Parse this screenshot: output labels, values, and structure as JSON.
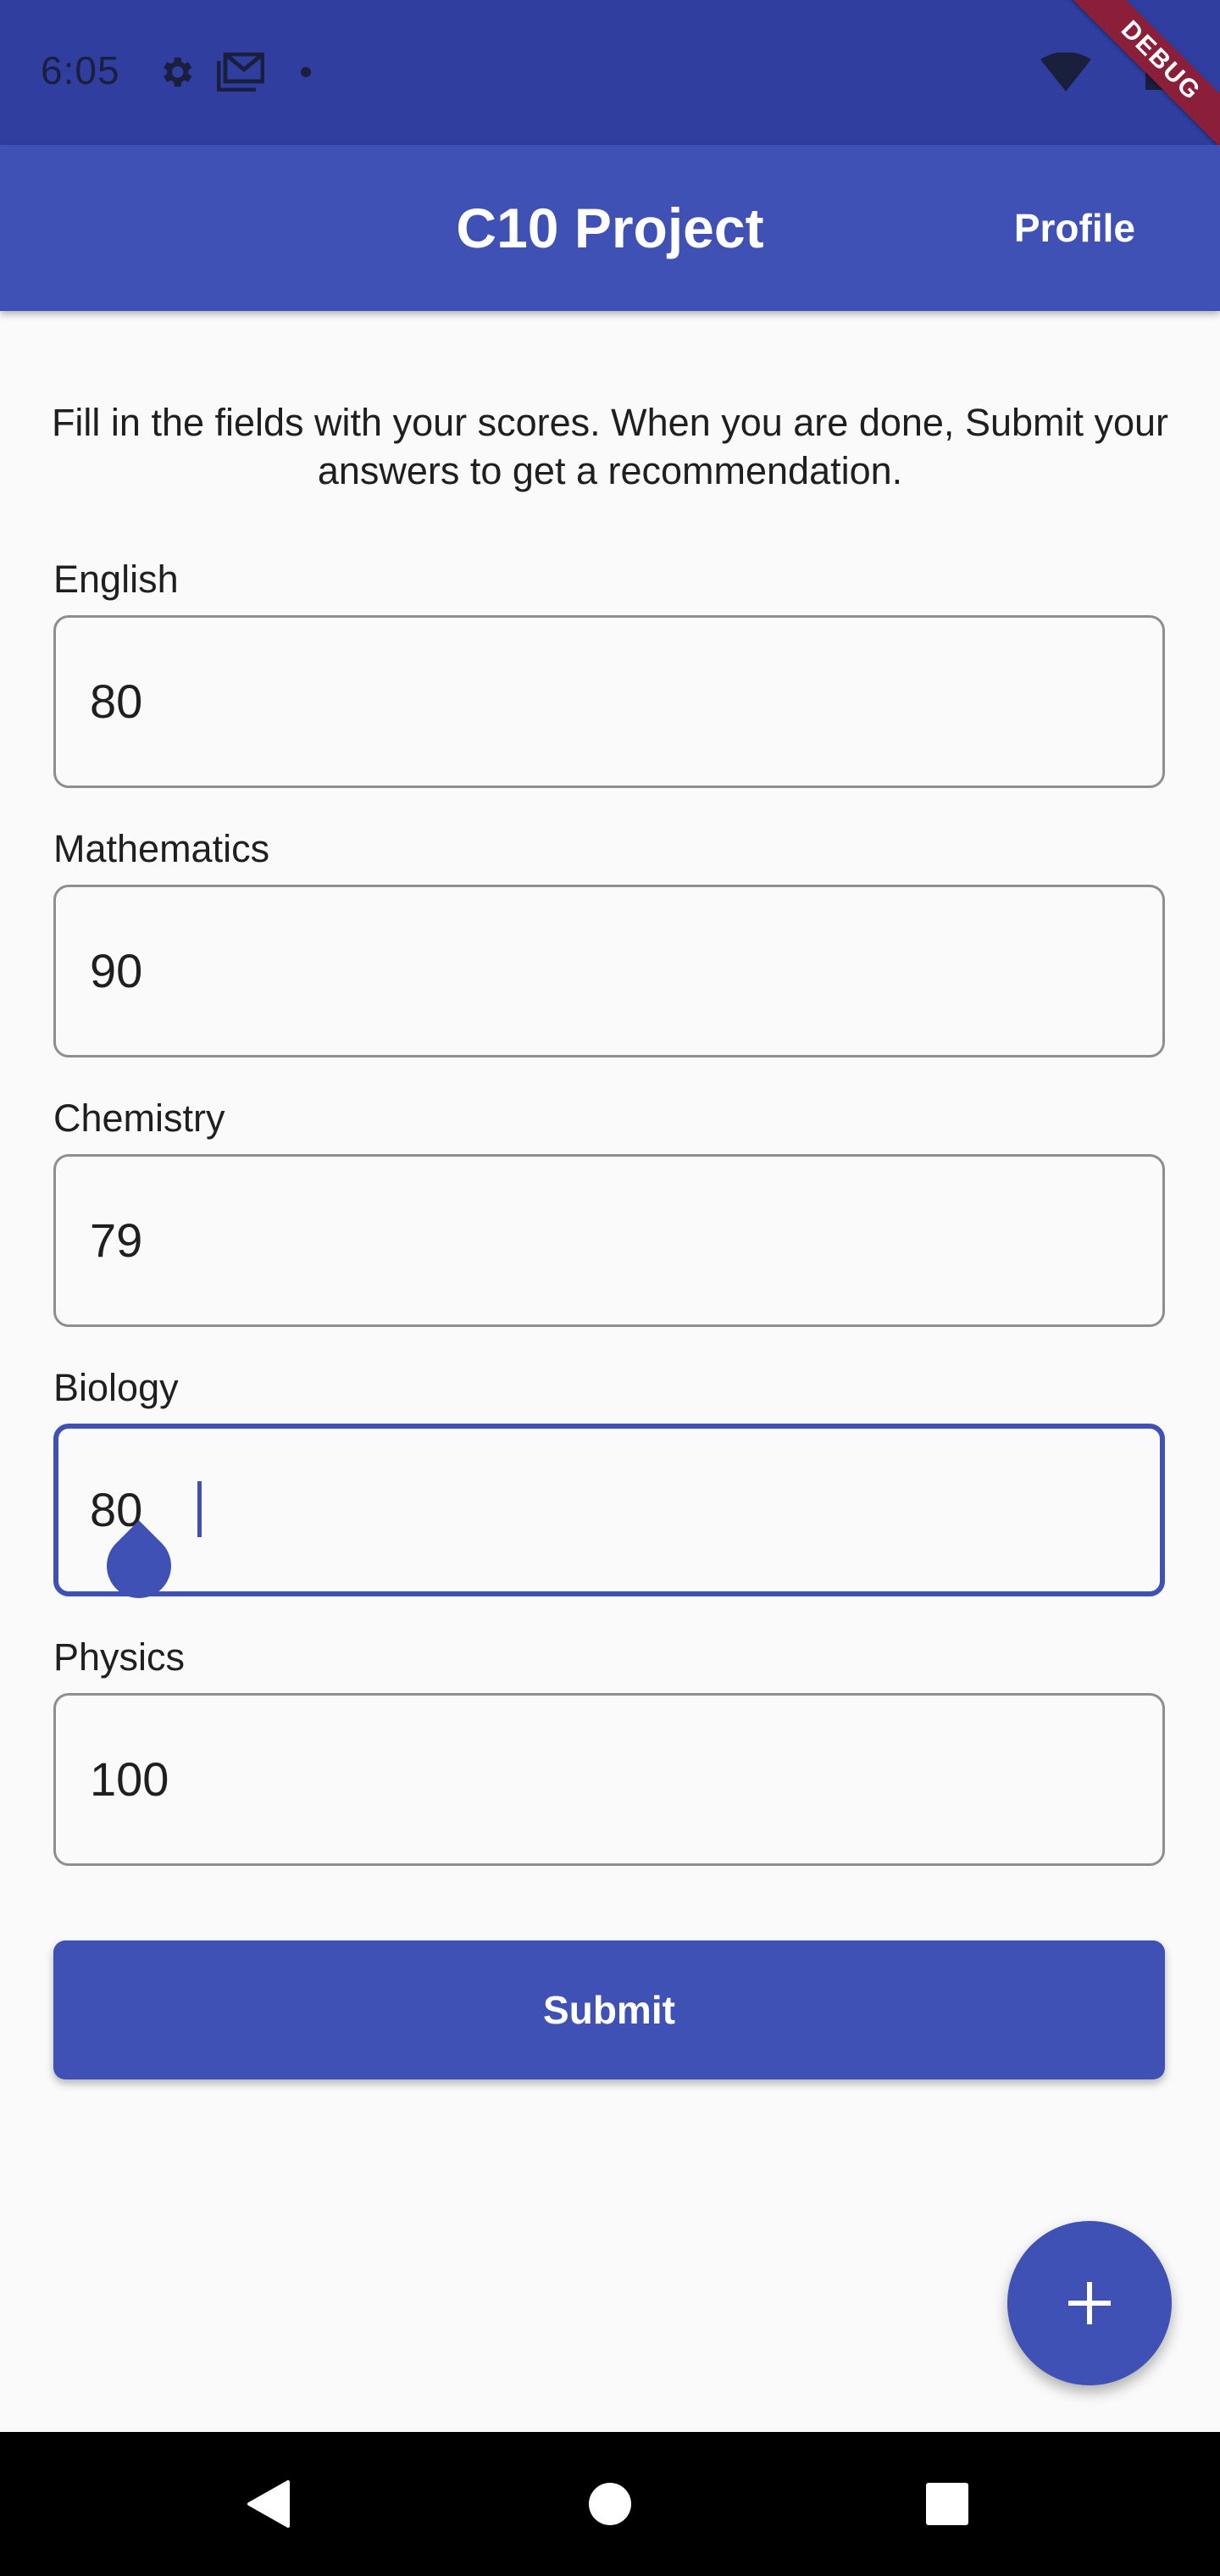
{
  "status_bar": {
    "time": "6:05",
    "icons": [
      "settings-icon",
      "gmail-icon",
      "notification-dot-icon",
      "wifi-icon",
      "battery-icon"
    ],
    "debug_banner": "DEBUG"
  },
  "app_bar": {
    "title": "C10 Project",
    "action_label": "Profile"
  },
  "intro_text": "Fill in the fields with your scores. When you are done, Submit your answers to get a recommendation.",
  "fields": [
    {
      "label": "English",
      "value": "80",
      "focused": false
    },
    {
      "label": "Mathematics",
      "value": "90",
      "focused": false
    },
    {
      "label": "Chemistry",
      "value": "79",
      "focused": false
    },
    {
      "label": "Biology",
      "value": "80",
      "focused": true
    },
    {
      "label": "Physics",
      "value": "100",
      "focused": false
    }
  ],
  "submit_label": "Submit",
  "fab": {
    "icon": "add-icon"
  },
  "nav_bar": {
    "icons": [
      "back-icon",
      "home-icon",
      "recents-icon"
    ]
  },
  "colors": {
    "primary": "#3f51b5",
    "primary_dark": "#303f9f",
    "background": "#fafafa",
    "debug_banner": "#8b1f3a"
  }
}
